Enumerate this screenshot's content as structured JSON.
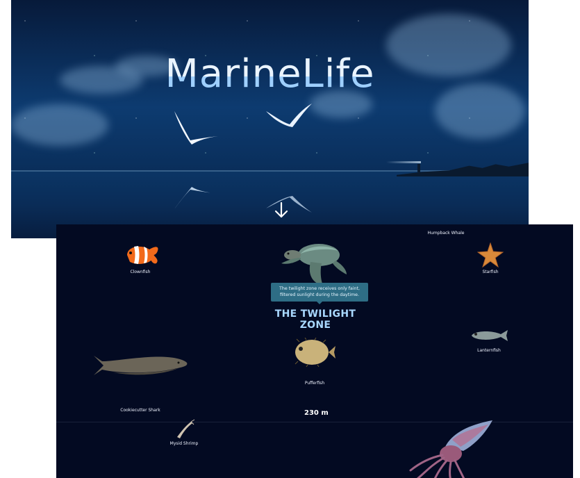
{
  "hero": {
    "title": "MarineLife",
    "scroll_icon": "down-arrow-icon"
  },
  "zone": {
    "tooltip": "The twilight zone receives only faint, filtered sunlight during the daytime.",
    "title": "THE TWILIGHT ZONE",
    "depth": "230 m"
  },
  "creatures": {
    "clownfish": "Clownfish",
    "humpback_whale": "Humpback Whale",
    "starfish": "Starfish",
    "lanternfish": "Lanternfish",
    "pufferfish": "Pufferfish",
    "cookiecutter_shark": "Cookiecutter Shark",
    "mysid_shrimp": "Mysid Shrimp"
  },
  "colors": {
    "ocean_bg": "#030a22",
    "zone_title": "#a9d8ff",
    "tooltip_bg": "#2e6d85"
  }
}
